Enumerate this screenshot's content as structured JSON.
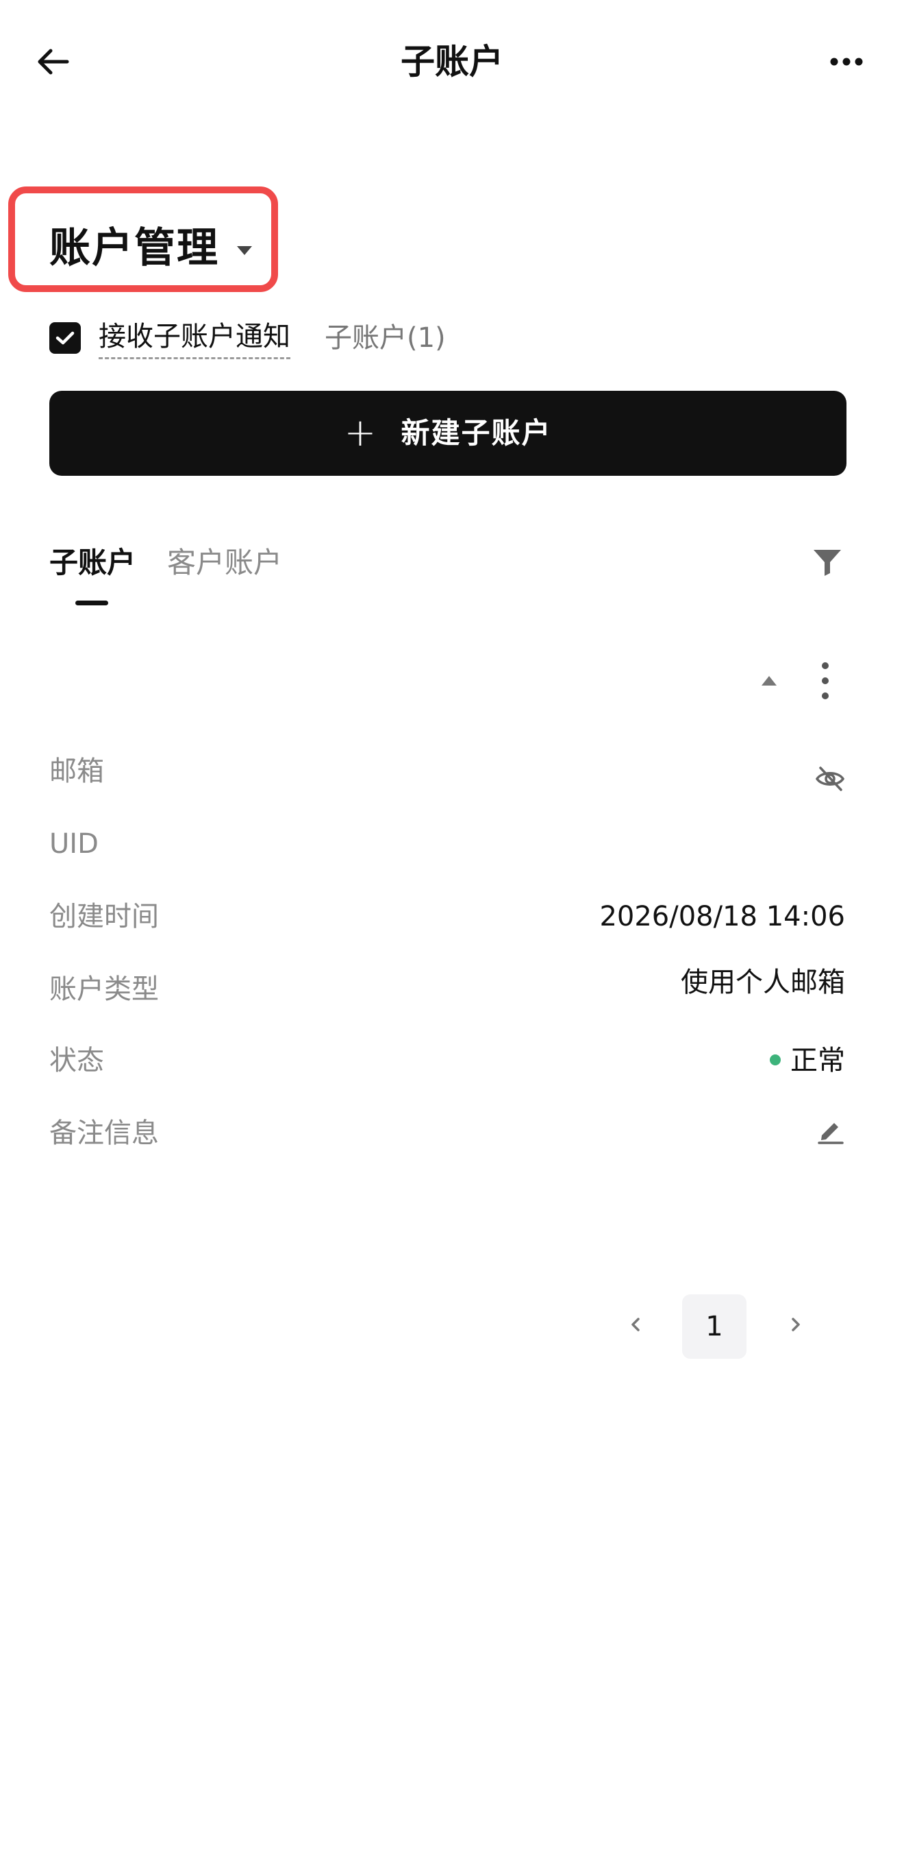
{
  "nav": {
    "title": "子账户"
  },
  "account_header": {
    "title": "账户管理"
  },
  "notification": {
    "label": "接收子账户通知",
    "checked": true,
    "sub_account_count_label": "子账户(1)"
  },
  "create_button": {
    "label": "新建子账户"
  },
  "tabs": [
    {
      "label": "子账户",
      "active": true
    },
    {
      "label": "客户账户",
      "active": false
    }
  ],
  "details": {
    "email_label": "邮箱",
    "uid_label": "UID",
    "created_label": "创建时间",
    "created_value": "2026/08/18 14:06",
    "type_label": "账户类型",
    "type_value": "使用个人邮箱",
    "status_label": "状态",
    "status_value": "正常",
    "status_color": "#3db37b",
    "note_label": "备注信息"
  },
  "pagination": {
    "current_page": "1"
  },
  "colors": {
    "highlight": "#f04a4a",
    "primary": "#111111"
  }
}
